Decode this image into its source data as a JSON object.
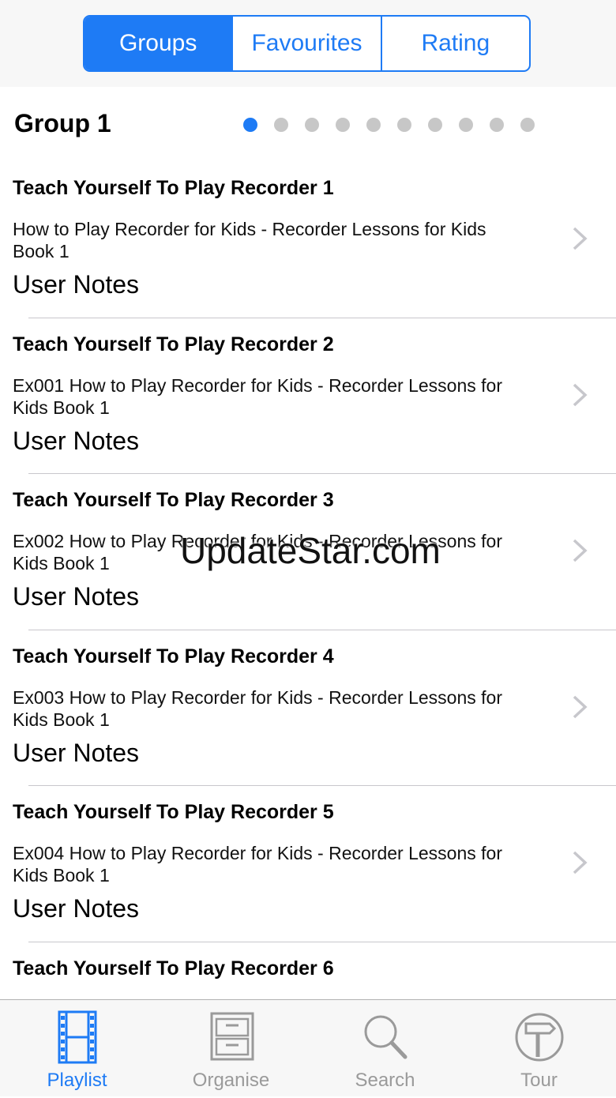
{
  "segments": [
    {
      "label": "Groups",
      "active": true
    },
    {
      "label": "Favourites",
      "active": false
    },
    {
      "label": "Rating",
      "active": false
    }
  ],
  "group": {
    "title": "Group 1",
    "page_count": 10,
    "current_page": 1
  },
  "items": [
    {
      "title": "Teach Yourself To Play Recorder 1",
      "subtitle": "How to Play Recorder for Kids - Recorder Lessons for Kids Book 1",
      "notes": "User Notes"
    },
    {
      "title": "Teach Yourself To Play Recorder 2",
      "subtitle": "Ex001 How to Play Recorder for Kids - Recorder Lessons for Kids Book 1",
      "notes": "User Notes"
    },
    {
      "title": "Teach Yourself To Play Recorder 3",
      "subtitle": "Ex002 How to Play Recorder for Kids - Recorder Lessons for Kids Book 1",
      "notes": "User Notes"
    },
    {
      "title": "Teach Yourself To Play Recorder 4",
      "subtitle": "Ex003 How to Play Recorder for Kids - Recorder Lessons for Kids Book 1",
      "notes": "User Notes"
    },
    {
      "title": "Teach Yourself To Play Recorder 5",
      "subtitle": "Ex004 How to Play Recorder for Kids - Recorder Lessons for Kids Book 1",
      "notes": "User Notes"
    },
    {
      "title": "Teach Yourself To Play Recorder 6",
      "subtitle": "",
      "notes": ""
    }
  ],
  "watermark": "UpdateStar.com",
  "tabs": [
    {
      "label": "Playlist",
      "icon": "film-strip-icon",
      "active": true
    },
    {
      "label": "Organise",
      "icon": "cabinet-icon",
      "active": false
    },
    {
      "label": "Search",
      "icon": "search-icon",
      "active": false
    },
    {
      "label": "Tour",
      "icon": "signpost-icon",
      "active": false
    }
  ],
  "colors": {
    "accent": "#1e7bf5",
    "inactive": "#9a9a9a",
    "separator": "#c8c7cc"
  }
}
